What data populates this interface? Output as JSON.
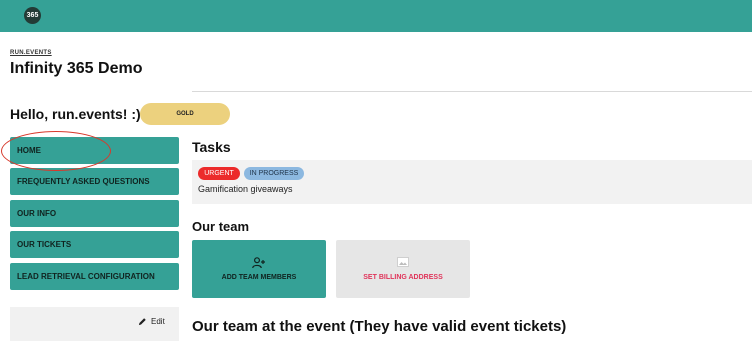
{
  "header": {
    "logo_text": "365"
  },
  "org": {
    "label": "RUN.EVENTS"
  },
  "page": {
    "title": "Infinity 365 Demo"
  },
  "greeting": {
    "text": "Hello, run.events! :)",
    "badge": "GOLD"
  },
  "nav": {
    "items": [
      {
        "label": "HOME"
      },
      {
        "label": "FREQUENTLY ASKED QUESTIONS"
      },
      {
        "label": "OUR INFO"
      },
      {
        "label": "OUR TICKETS"
      },
      {
        "label": "LEAD RETRIEVAL CONFIGURATION"
      }
    ],
    "edit_label": "Edit"
  },
  "tasks": {
    "title": "Tasks",
    "items": [
      {
        "tags": [
          "URGENT",
          "IN PROGRESS"
        ],
        "name": "Gamification giveaways"
      }
    ]
  },
  "team": {
    "title": "Our team",
    "actions": [
      {
        "label": "ADD TEAM MEMBERS",
        "icon": "add-person-icon"
      },
      {
        "label": "SET BILLING ADDRESS",
        "icon": "image-icon"
      }
    ]
  },
  "event_team": {
    "title": "Our team at the event (They have valid event tickets)"
  },
  "colors": {
    "brand": "#35a196",
    "badge_gold": "#ecd17e",
    "urgent": "#ec2b2b",
    "in_progress": "#8cb8e0",
    "billing_text": "#e0345a",
    "highlight_circle": "#d7392c"
  }
}
